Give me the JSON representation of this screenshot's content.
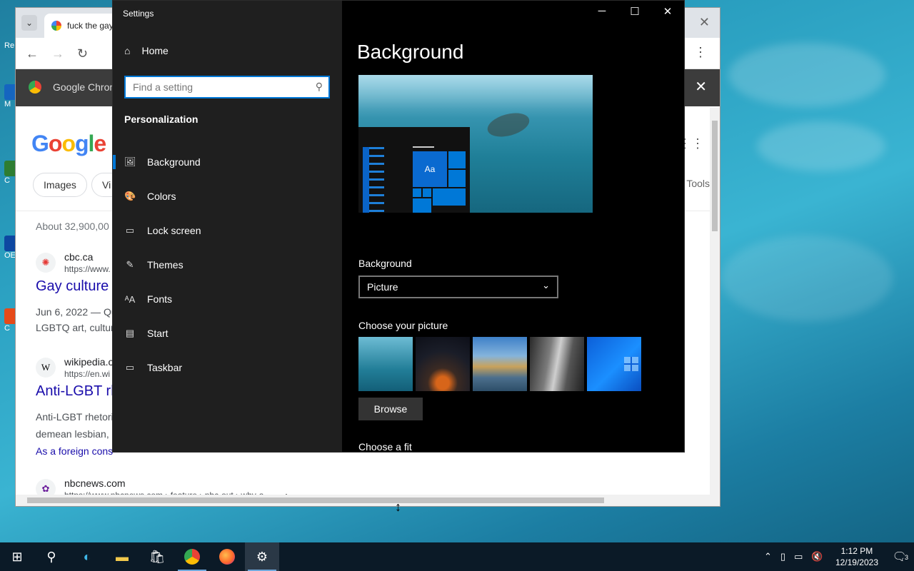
{
  "desktop": {
    "icons": [
      "Re",
      "M",
      "C",
      "OE",
      "C"
    ]
  },
  "chrome": {
    "tab_title": "fuck the gay",
    "infobar_label": "Google Chrom",
    "search_page": {
      "logo_letters": [
        "G",
        "o",
        "o",
        "g",
        "l",
        "e"
      ],
      "chips": [
        "Images",
        "Vi"
      ],
      "tools": "Tools",
      "result_count": "About 32,900,00",
      "results": [
        {
          "site": "cbc.ca",
          "url": "https://www.",
          "title": "Gay culture i",
          "snippets": [
            "Jun 6, 2022 — Qu",
            "LGBTQ art, culture"
          ]
        },
        {
          "site": "wikipedia.o",
          "url": "https://en.wi",
          "title": "Anti-LGBT rh",
          "snippets": [
            "Anti-LGBT rhetoric",
            "demean lesbian, g",
            "As a foreign cons"
          ]
        },
        {
          "site": "nbcnews.com",
          "url": "https://www.nbcnews.com › feature › nbc-out › why-a",
          "title": "",
          "snippets": []
        }
      ]
    }
  },
  "settings": {
    "window_title": "Settings",
    "home_label": "Home",
    "search_placeholder": "Find a setting",
    "section": "Personalization",
    "nav": [
      {
        "label": "Background",
        "icon": "picture-icon",
        "glyph": "🖼",
        "active": true
      },
      {
        "label": "Colors",
        "icon": "palette-icon",
        "glyph": "🎨",
        "active": false
      },
      {
        "label": "Lock screen",
        "icon": "lock-screen-icon",
        "glyph": "▭",
        "active": false
      },
      {
        "label": "Themes",
        "icon": "themes-icon",
        "glyph": "✎",
        "active": false
      },
      {
        "label": "Fonts",
        "icon": "fonts-icon",
        "glyph": "ᴬA",
        "active": false
      },
      {
        "label": "Start",
        "icon": "start-icon",
        "glyph": "▤",
        "active": false
      },
      {
        "label": "Taskbar",
        "icon": "taskbar-icon",
        "glyph": "▭",
        "active": false
      }
    ],
    "page_title": "Background",
    "preview_tile_text": "Aa",
    "background_label": "Background",
    "background_value": "Picture",
    "choose_picture_label": "Choose your picture",
    "browse_label": "Browse",
    "choose_fit_label": "Choose a fit"
  },
  "taskbar": {
    "time": "1:12 PM",
    "date": "12/19/2023",
    "notification_count": "3"
  }
}
